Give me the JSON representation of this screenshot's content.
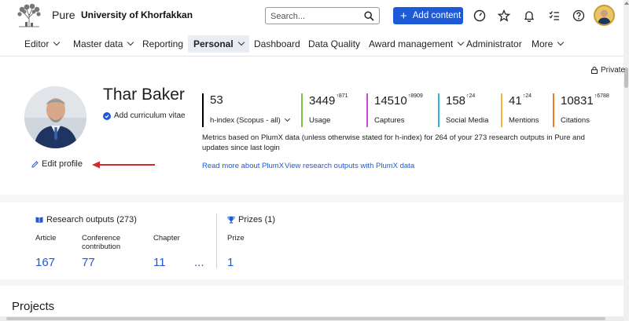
{
  "header": {
    "app_name": "Pure",
    "org_name": "University of Khorfakkan",
    "search_placeholder": "Search...",
    "add_content_label": "Add content",
    "accent_color": "#1e5ad6"
  },
  "nav": {
    "items": [
      {
        "label": "Editor"
      },
      {
        "label": "Master data"
      },
      {
        "label": "Reporting"
      },
      {
        "label": "Personal"
      },
      {
        "label": "Dashboard"
      },
      {
        "label": "Data Quality"
      },
      {
        "label": "Award management"
      },
      {
        "label": "Administrator"
      },
      {
        "label": "More"
      }
    ]
  },
  "profile": {
    "visibility": "Private",
    "name": "Thar Baker",
    "cv_label": "Add curriculum vitae",
    "edit_label": "Edit profile",
    "metrics": [
      {
        "value": "53",
        "sup": "",
        "label": "h-index (Scopus - all)",
        "color": "#000000"
      },
      {
        "value": "3449",
        "sup": "↑871",
        "label": "Usage",
        "color": "#7bc142"
      },
      {
        "value": "14510",
        "sup": "↑8909",
        "label": "Captures",
        "color": "#c84dd6"
      },
      {
        "value": "158",
        "sup": "↑24",
        "label": "Social Media",
        "color": "#2fb6d8"
      },
      {
        "value": "41",
        "sup": "↑24",
        "label": "Mentions",
        "color": "#f2b33d"
      },
      {
        "value": "10831",
        "sup": "↑6788",
        "label": "Citations",
        "color": "#f07a2a"
      }
    ],
    "plumx_note": "Metrics based on PlumX data (unless otherwise stated for h-index) for 264 of your 273 research outputs in Pure and updates since last login",
    "links": {
      "read_more": "Read more about PlumX",
      "view_outputs": "View research outputs with PlumX data"
    }
  },
  "research_outputs": {
    "title": "Research outputs (273)",
    "items": [
      {
        "label": "Article",
        "value": "167"
      },
      {
        "label": "Conference contribution",
        "value": "77"
      },
      {
        "label": "Chapter",
        "value": "11"
      }
    ],
    "more": "..."
  },
  "prizes": {
    "title": "Prizes (1)",
    "items": [
      {
        "label": "Prize",
        "value": "1"
      }
    ]
  },
  "projects": {
    "title": "Projects"
  }
}
